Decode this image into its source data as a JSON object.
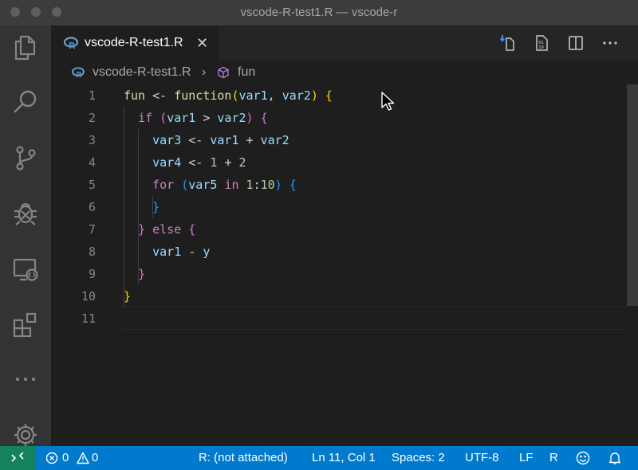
{
  "window": {
    "title": "vscode-R-test1.R — vscode-r"
  },
  "activity_bar": {
    "items": [
      {
        "name": "explorer-icon"
      },
      {
        "name": "search-icon"
      },
      {
        "name": "source-control-icon"
      },
      {
        "name": "debug-icon"
      },
      {
        "name": "remote-explorer-icon"
      },
      {
        "name": "extensions-icon"
      },
      {
        "name": "more-icon"
      },
      {
        "name": "settings-gear-icon"
      }
    ]
  },
  "tabs": [
    {
      "label": "vscode-R-test1.R",
      "icon": "r-file-icon",
      "active": true,
      "close": "✕"
    }
  ],
  "tab_actions": [
    {
      "name": "run-source-icon"
    },
    {
      "name": "binary-file-icon"
    },
    {
      "name": "split-editor-icon"
    },
    {
      "name": "more-actions-icon"
    }
  ],
  "breadcrumb": {
    "file": "vscode-R-test1.R",
    "separator": "›",
    "symbol": "fun"
  },
  "editor": {
    "line_numbers": [
      "1",
      "2",
      "3",
      "4",
      "5",
      "6",
      "7",
      "8",
      "9",
      "10",
      "11"
    ],
    "active_line": "11"
  },
  "status_bar": {
    "errors": "0",
    "warnings": "0",
    "r_status": "R: (not attached)",
    "cursor_position": "Ln 11, Col 1",
    "indentation": "Spaces: 2",
    "encoding": "UTF-8",
    "eol": "LF",
    "language": "R"
  },
  "colors": {
    "activity_bar": "#333333",
    "editor_background": "#1e1e1e",
    "status_bar": "#007acc",
    "remote_indicator": "#16825d",
    "keyword": "#c586c0",
    "function": "#dcdcaa",
    "identifier": "#9cdcfe",
    "number": "#b5cea8",
    "bracket_level_1": "#ffd700",
    "bracket_level_2": "#da70d6",
    "bracket_level_3": "#179fff"
  }
}
